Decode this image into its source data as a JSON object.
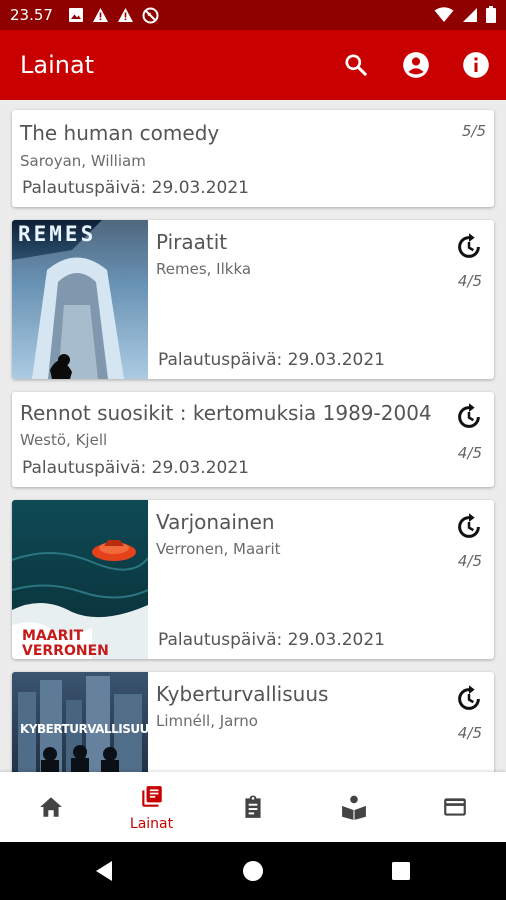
{
  "status_bar": {
    "time": "23.57",
    "icons": [
      "photo-icon",
      "warning-icon",
      "warning-icon",
      "blocked-icon",
      "wifi-icon",
      "signal-icon",
      "battery-icon"
    ]
  },
  "app_bar": {
    "title": "Lainat",
    "actions": [
      "search-icon",
      "account-icon",
      "info-icon"
    ]
  },
  "loans": [
    {
      "title": "The human comedy",
      "author": "Saroyan, William",
      "due": "Palautuspäivä: 29.03.2021",
      "renewals": "5/5",
      "has_cover": false,
      "renewable": false
    },
    {
      "title": "Piraatit",
      "author": "Remes, Ilkka",
      "due": "Palautuspäivä: 29.03.2021",
      "renewals": "4/5",
      "has_cover": true,
      "cover_text": "REMES",
      "renewable": true
    },
    {
      "title": "Rennot suosikit : kertomuksia 1989-2004",
      "author": "Westö, Kjell",
      "due": "Palautuspäivä: 29.03.2021",
      "renewals": "4/5",
      "has_cover": false,
      "renewable": true
    },
    {
      "title": "Varjonainen",
      "author": "Verronen, Maarit",
      "due": "Palautuspäivä: 29.03.2021",
      "renewals": "4/5",
      "has_cover": true,
      "cover_text_1": "MAARIT",
      "cover_text_2": "VERRONEN",
      "renewable": true
    },
    {
      "title": "Kyberturvallisuus",
      "author": "Limnéll, Jarno",
      "renewals": "4/5",
      "has_cover": true,
      "cover_text": "KYBERTURVALLISUUS",
      "renewable": true
    }
  ],
  "bottom_nav": {
    "items": [
      {
        "icon": "home-icon",
        "label": ""
      },
      {
        "icon": "library-books-icon",
        "label": "Lainat"
      },
      {
        "icon": "clipboard-icon",
        "label": ""
      },
      {
        "icon": "reading-icon",
        "label": ""
      },
      {
        "icon": "card-icon",
        "label": ""
      }
    ],
    "active": "Lainat"
  },
  "colors": {
    "primary": "#c80000",
    "status_bar": "#8f0000",
    "background": "#ececec"
  }
}
